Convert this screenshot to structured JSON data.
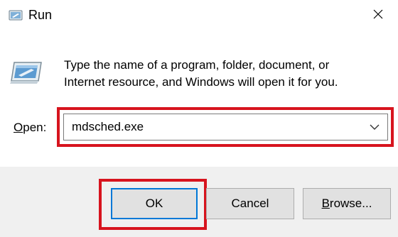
{
  "window": {
    "title": "Run",
    "app_icon": "run-icon",
    "close_icon": "close-icon"
  },
  "main": {
    "icon": "run-program-icon",
    "description_line1": "Type the name of a program, folder, document, or",
    "description_line2": "Internet resource, and Windows will open it for you.",
    "open_label_mnemonic": "O",
    "open_label_rest": "pen:",
    "input_value": "mdsched.exe"
  },
  "buttons": {
    "ok": "OK",
    "cancel": "Cancel",
    "browse_mnemonic": "B",
    "browse_rest": "rowse..."
  },
  "colors": {
    "highlight": "#d7141e",
    "default_button_border": "#0078d7",
    "footer_bg": "#f0f0f0"
  }
}
